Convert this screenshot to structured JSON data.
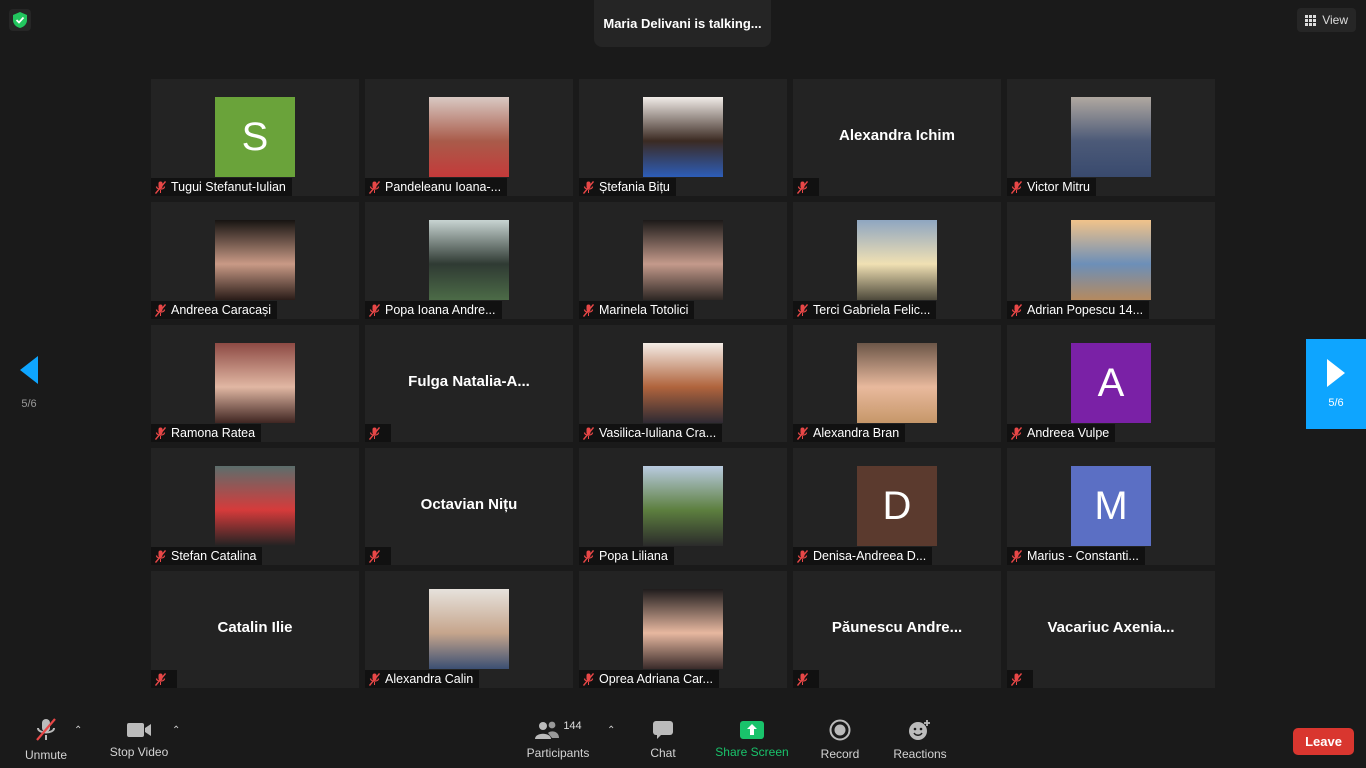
{
  "talking": "Maria Delivani is talking...",
  "view_label": "View",
  "page_indicator": "5/6",
  "participants": [
    {
      "name": "Tugui Stefanut-Iulian",
      "kind": "avatar",
      "letter": "S",
      "color": "#6aa33a"
    },
    {
      "name": "Pandeleanu Ioana-...",
      "kind": "photo",
      "colors": [
        "#d9c9c3",
        "#a95b4a",
        "#c43a3a"
      ]
    },
    {
      "name": "Ștefania Bițu",
      "kind": "photo",
      "colors": [
        "#f1ece8",
        "#3b2a22",
        "#2d5db8"
      ]
    },
    {
      "name": "",
      "display": "Alexandra Ichim",
      "kind": "name"
    },
    {
      "name": "Victor Mitru",
      "kind": "photo",
      "colors": [
        "#b0a8a0",
        "#4c5a78",
        "#394a6e"
      ]
    },
    {
      "name": "Andreea Caracași",
      "kind": "photo",
      "colors": [
        "#171412",
        "#c99a86",
        "#2a1c18"
      ]
    },
    {
      "name": "Popa Ioana Andre...",
      "kind": "photo",
      "colors": [
        "#c8d4d2",
        "#2f3a33",
        "#4c6b47"
      ]
    },
    {
      "name": "Marinela Totolici",
      "kind": "photo",
      "colors": [
        "#1c1a19",
        "#c49a8b",
        "#2e2724"
      ]
    },
    {
      "name": "Terci Gabriela Felic...",
      "kind": "photo",
      "colors": [
        "#8fa6c1",
        "#f0e0b3",
        "#4e4a3b"
      ]
    },
    {
      "name": "Adrian Popescu 14...",
      "kind": "photo",
      "colors": [
        "#f0c38a",
        "#6c8fb8",
        "#b58a5f"
      ]
    },
    {
      "name": "Ramona Ratea",
      "kind": "photo",
      "colors": [
        "#8d4a44",
        "#e1b7a3",
        "#402622"
      ]
    },
    {
      "name": "",
      "display": "Fulga  Natalia-A...",
      "kind": "name"
    },
    {
      "name": "Vasilica-Iuliana Cra...",
      "kind": "photo",
      "colors": [
        "#f4ece6",
        "#b0643d",
        "#2e2a33"
      ]
    },
    {
      "name": "Alexandra Bran",
      "kind": "photo",
      "colors": [
        "#6c5648",
        "#e8b99d",
        "#c69769"
      ]
    },
    {
      "name": "Andreea Vulpe",
      "kind": "avatar",
      "letter": "A",
      "color": "#7a21a6"
    },
    {
      "name": "Stefan Catalina",
      "kind": "photo",
      "colors": [
        "#5c6e6c",
        "#d63b3b",
        "#232323"
      ]
    },
    {
      "name": "",
      "display": "Octavian Nițu",
      "kind": "name"
    },
    {
      "name": "Popa Liliana",
      "kind": "photo",
      "colors": [
        "#b9cbe0",
        "#5d7f3f",
        "#2b2b2b"
      ]
    },
    {
      "name": "Denisa-Andreea D...",
      "kind": "avatar",
      "letter": "D",
      "color": "#5b3a2e"
    },
    {
      "name": "Marius - Constanti...",
      "kind": "avatar",
      "letter": "M",
      "color": "#5b6fc4"
    },
    {
      "name": "",
      "display": "Catalin Ilie",
      "kind": "name"
    },
    {
      "name": "Alexandra Calin",
      "kind": "photo",
      "colors": [
        "#e6e2dc",
        "#c6a58c",
        "#3b4f73"
      ]
    },
    {
      "name": "Oprea Adriana Car...",
      "kind": "photo",
      "colors": [
        "#1f1c1d",
        "#e7b8a0",
        "#3a2b2a"
      ]
    },
    {
      "name": "",
      "display": "Păunescu  Andre...",
      "kind": "name"
    },
    {
      "name": "",
      "display": "Vacariuc  Axenia...",
      "kind": "name"
    }
  ],
  "toolbar": {
    "unmute": "Unmute",
    "stop_video": "Stop Video",
    "participants": "Participants",
    "participant_count": "144",
    "chat": "Chat",
    "share_screen": "Share Screen",
    "record": "Record",
    "reactions": "Reactions",
    "leave": "Leave"
  },
  "colors": {
    "accent": "#0ea5ff",
    "share": "#19c36b",
    "leave": "#d9362f",
    "mute": "#e84747"
  }
}
